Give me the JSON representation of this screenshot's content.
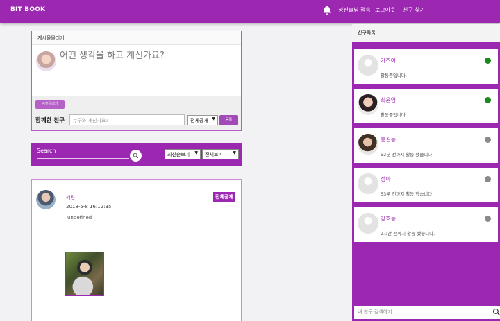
{
  "header": {
    "brand": "BIT BOOK",
    "user_status": "정진솔님 접속",
    "logout": "로그아웃",
    "find_friends": "친구 찾기",
    "bell_icon": "bell-icon"
  },
  "composer": {
    "title": "게시물올리기",
    "placeholder": "어떤 생각을 하고 계신가요?",
    "photo_button": "사진올리기",
    "together_label": "함께한 친구",
    "friend_placeholder": "누구와 계신가요?",
    "scope_selected": "전체공개",
    "submit": "등록"
  },
  "search": {
    "label": "Search",
    "sort_selected": "최신순보기",
    "filter_selected": "전체보기"
  },
  "post": {
    "author": "혜린",
    "timestamp": "2018-5-8 16:12:35",
    "body": "undefined",
    "visibility": "전체공개"
  },
  "friends": {
    "title": "친구목록",
    "search_placeholder": "내 친구 검색하기",
    "items": [
      {
        "name": "가즈아",
        "status": "활동중입니다.",
        "online": true
      },
      {
        "name": "최윤영",
        "status": "활동중입니다.",
        "online": true
      },
      {
        "name": "홍길동",
        "status": "52분 전까지 활동 했습니다.",
        "online": false
      },
      {
        "name": "정아",
        "status": "53분 전까지 활동 했습니다.",
        "online": false
      },
      {
        "name": "강호동",
        "status": "2시간 전까지 활동 했습니다.",
        "online": false
      }
    ]
  },
  "colors": {
    "accent": "#9c27b0",
    "online": "#1b8a1b",
    "offline": "#8a8a8a"
  }
}
